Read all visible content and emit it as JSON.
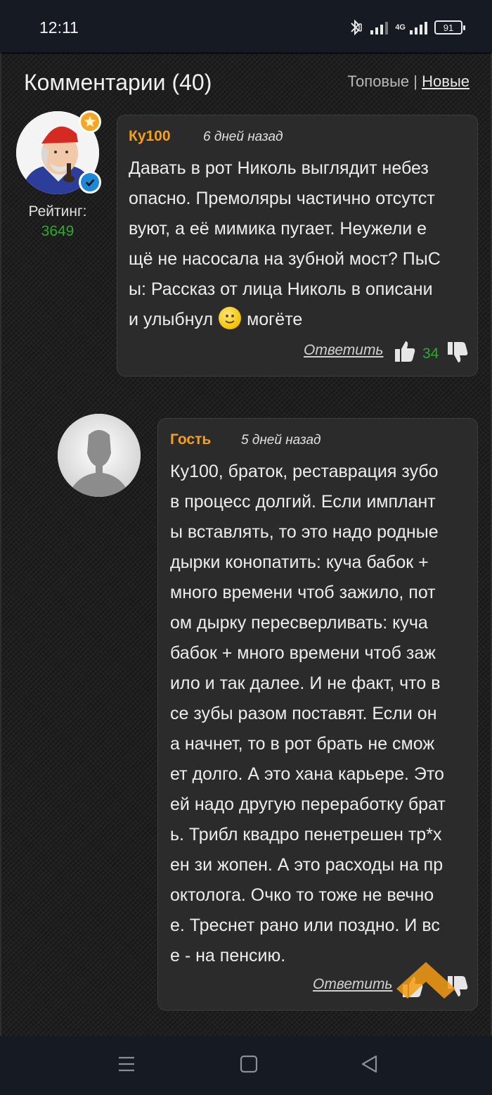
{
  "status_bar": {
    "time": "12:11",
    "network": "4G",
    "battery": "91",
    "icons": [
      "bluetooth-icon",
      "signal-icon",
      "signal-4g-icon",
      "battery-icon"
    ]
  },
  "comments_section": {
    "title": "Комментарии (40)",
    "sort_top": "Топовые",
    "sort_separator": "|",
    "sort_new": "Новые"
  },
  "comments": [
    {
      "author": "Ку100",
      "time": "6 дней назад",
      "rating_label": "Рейтинг:",
      "rating_value": "3649",
      "lines": [
        "Давать в рот Николь выглядит небез",
        "опасно. Премоляры частично отсутст",
        "вуют, а её мимика пугает. Неужели е",
        "щё не насосала на зубной мост? ПыС",
        "ы: Рассказ от лица Николь в описани"
      ],
      "last_line_before": "и улыбнул",
      "last_line_after": "могёте",
      "reply_label": "Ответить",
      "likes": "34"
    },
    {
      "author": "Гость",
      "time": "5 дней назад",
      "lines": [
        "Ку100, браток, реставрация зубо",
        "в процесс долгий. Если имплант",
        "ы вставлять, то это надо родные",
        "дырки конопатить: куча бабок +",
        "много времени чтоб зажило, пот",
        "ом дырку пересверливать: куча",
        "бабок + много времени чтоб заж",
        "ило и так далее. И не факт, что в",
        "се зубы разом поставят. Если он",
        "а начнет, то в рот брать не смож",
        "ет долго. А это хана карьере. Это",
        "ей надо другую переработку брат",
        "ь. Трибл квадро пенетрешен тр*х",
        "ен зи жопен. А это расходы на пр",
        "октолога. Очко то тоже не вечно",
        "е. Треснет рано или поздно. И вс",
        "е - на пенсию."
      ],
      "reply_label": "Ответить"
    }
  ],
  "colors": {
    "accent_author": "#f5a01a",
    "rating_green": "#2fa832",
    "scroll_button": "#f39c12"
  }
}
